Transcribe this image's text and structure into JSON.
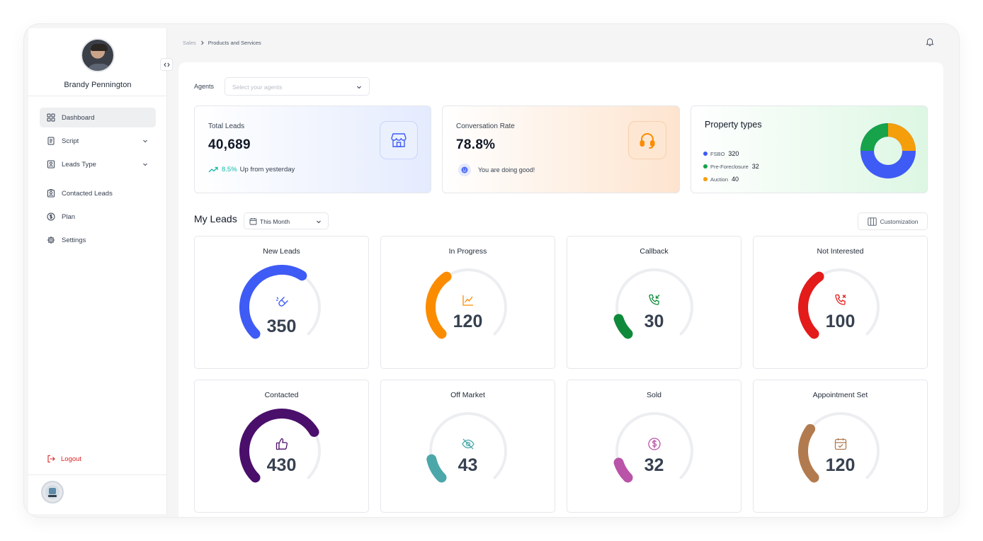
{
  "profile": {
    "name": "Brandy Pennington"
  },
  "sidebar": {
    "items": [
      {
        "label": "Dashboard",
        "icon": "dashboard-icon"
      },
      {
        "label": "Script",
        "icon": "script-icon",
        "has_chevron": true
      },
      {
        "label": "Leads Type",
        "icon": "leads-type-icon",
        "has_chevron": true
      },
      {
        "label": "Contacted Leads",
        "icon": "contacted-leads-icon"
      },
      {
        "label": "Plan",
        "icon": "plan-icon"
      },
      {
        "label": "Settings",
        "icon": "settings-icon"
      }
    ],
    "active_item": "Dashboard",
    "logout_label": "Logout"
  },
  "breadcrumb": {
    "parent": "Sales",
    "current": "Products and Services"
  },
  "agents": {
    "label": "Agents",
    "placeholder": "Select your agents"
  },
  "stats": {
    "total_leads": {
      "title": "Total Leads",
      "value": "40,689",
      "trend_pct": "8.5%",
      "trend_text": "Up from yesterday"
    },
    "conversation_rate": {
      "title": "Conversation Rate",
      "value": "78.8%",
      "note": "You are doing good!"
    },
    "property_types": {
      "title": "Property types",
      "items": [
        {
          "label": "FSBO",
          "value": "320",
          "color": "#3e5bf5"
        },
        {
          "label": "Pre-Foreclosure",
          "value": "32",
          "color": "#16a34a"
        },
        {
          "label": "Auction",
          "value": "40",
          "color": "#f59e0b"
        }
      ]
    }
  },
  "my_leads": {
    "title": "My Leads",
    "period": "This Month",
    "customization_label": "Customization",
    "cards": [
      {
        "title": "New Leads",
        "value": "350",
        "fill": 0.62,
        "color": "#3e5bf5",
        "icon": "magnet-icon"
      },
      {
        "title": "In Progress",
        "value": "120",
        "fill": 0.37,
        "color": "#fb8c00",
        "icon": "chart-line-icon"
      },
      {
        "title": "Callback",
        "value": "30",
        "fill": 0.1,
        "color": "#0f8a3a",
        "icon": "phone-callback-icon"
      },
      {
        "title": "Not Interested",
        "value": "100",
        "fill": 0.37,
        "color": "#e31b1b",
        "icon": "phone-missed-icon"
      },
      {
        "title": "Contacted",
        "value": "430",
        "fill": 0.72,
        "color": "#4a0f6b",
        "icon": "thumbs-up-icon"
      },
      {
        "title": "Off Market",
        "value": "43",
        "fill": 0.12,
        "color": "#4ba7aa",
        "icon": "eye-off-icon"
      },
      {
        "title": "Sold",
        "value": "32",
        "fill": 0.1,
        "color": "#b954a8",
        "icon": "dollar-circle-icon"
      },
      {
        "title": "Appointment Set",
        "value": "120",
        "fill": 0.3,
        "color": "#b27b4f",
        "icon": "calendar-icon"
      }
    ]
  }
}
